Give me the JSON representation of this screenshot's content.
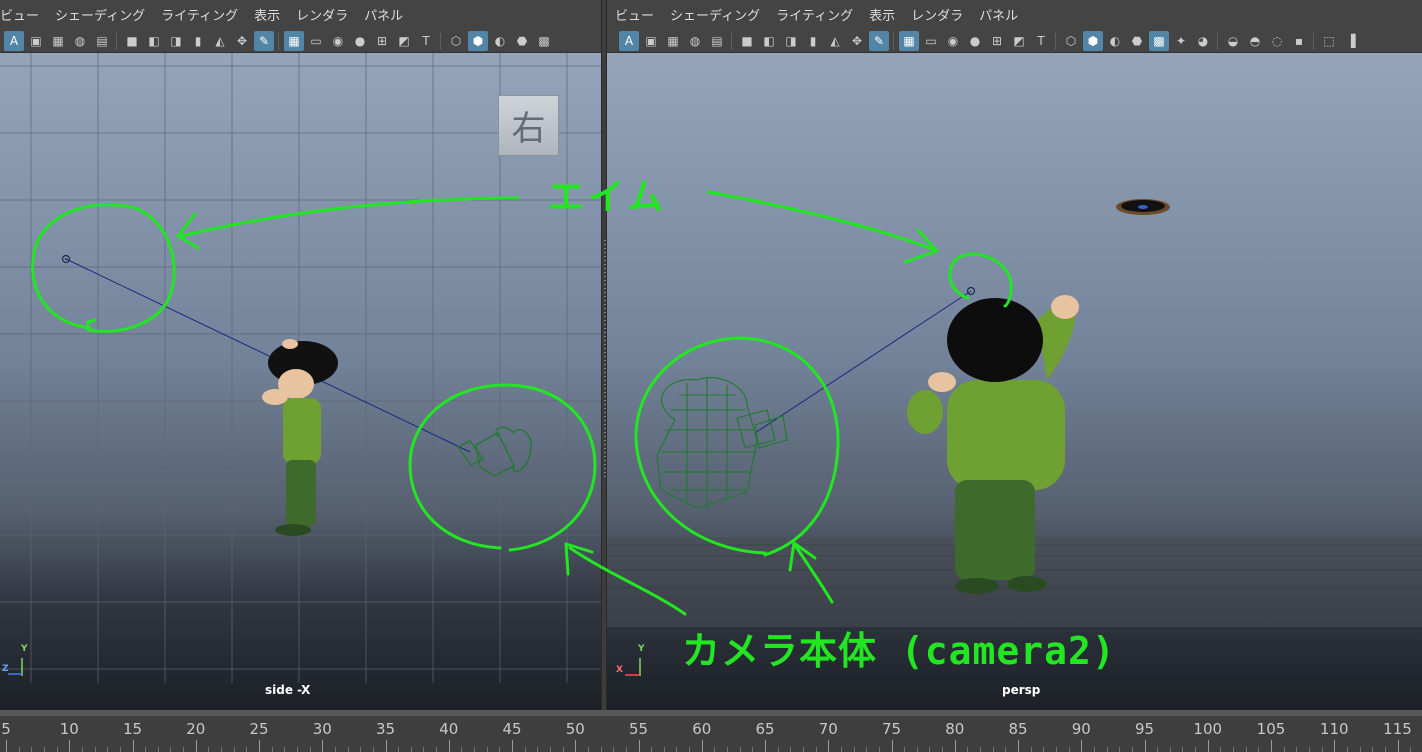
{
  "menus": [
    "ビュー",
    "シェーディング",
    "ライティング",
    "表示",
    "レンダラ",
    "パネル"
  ],
  "toolbar": {
    "left_icons": [
      "select-camera-icon",
      "camera-attributes-icon",
      "bookmark-icon",
      "image-plane-icon",
      "2d-pan-zoom-icon",
      "camera-icon",
      "camera-sequence-icon",
      "camera-lock-icon",
      "grease-pencil-icon",
      "grid-icon",
      "film-gate-icon",
      "resolution-gate-icon",
      "gate-mask-icon",
      "field-chart-icon",
      "safe-action-icon",
      "safe-title-icon",
      "wireframe-icon",
      "smooth-shade-icon",
      "default-material-icon",
      "wireframe-on-shaded-icon",
      "xray-icon"
    ],
    "right_extra_icons": [
      "use-all-lights-icon",
      "shadows-icon",
      "screen-space-ao-icon",
      "motion-blur-icon",
      "anti-aliasing-icon",
      "depth-of-field-icon",
      "isolate-select-icon",
      "xray-joints-icon"
    ]
  },
  "viewports": {
    "left": {
      "camera_name": "side -X",
      "viewcube_label": "右",
      "axis_labels": {
        "y": "Y",
        "z": "Z"
      }
    },
    "right": {
      "camera_name": "persp",
      "axis_labels": {
        "y": "Y",
        "x": "X"
      }
    }
  },
  "annotations": {
    "aim_label": "エイム",
    "camera_label": "カメラ本体 (camera2)",
    "color": "#22e622"
  },
  "timeline": {
    "ticks": [
      5,
      10,
      15,
      20,
      25,
      30,
      35,
      40,
      45,
      50,
      55,
      60,
      65,
      70,
      75,
      80,
      85,
      90,
      95,
      100,
      105,
      110,
      115
    ]
  },
  "colors": {
    "ui_bg": "#444444",
    "toolbar_active": "#5285a6",
    "camera_wire": "#1f7a2e",
    "aim_line": "#1a2a80"
  }
}
